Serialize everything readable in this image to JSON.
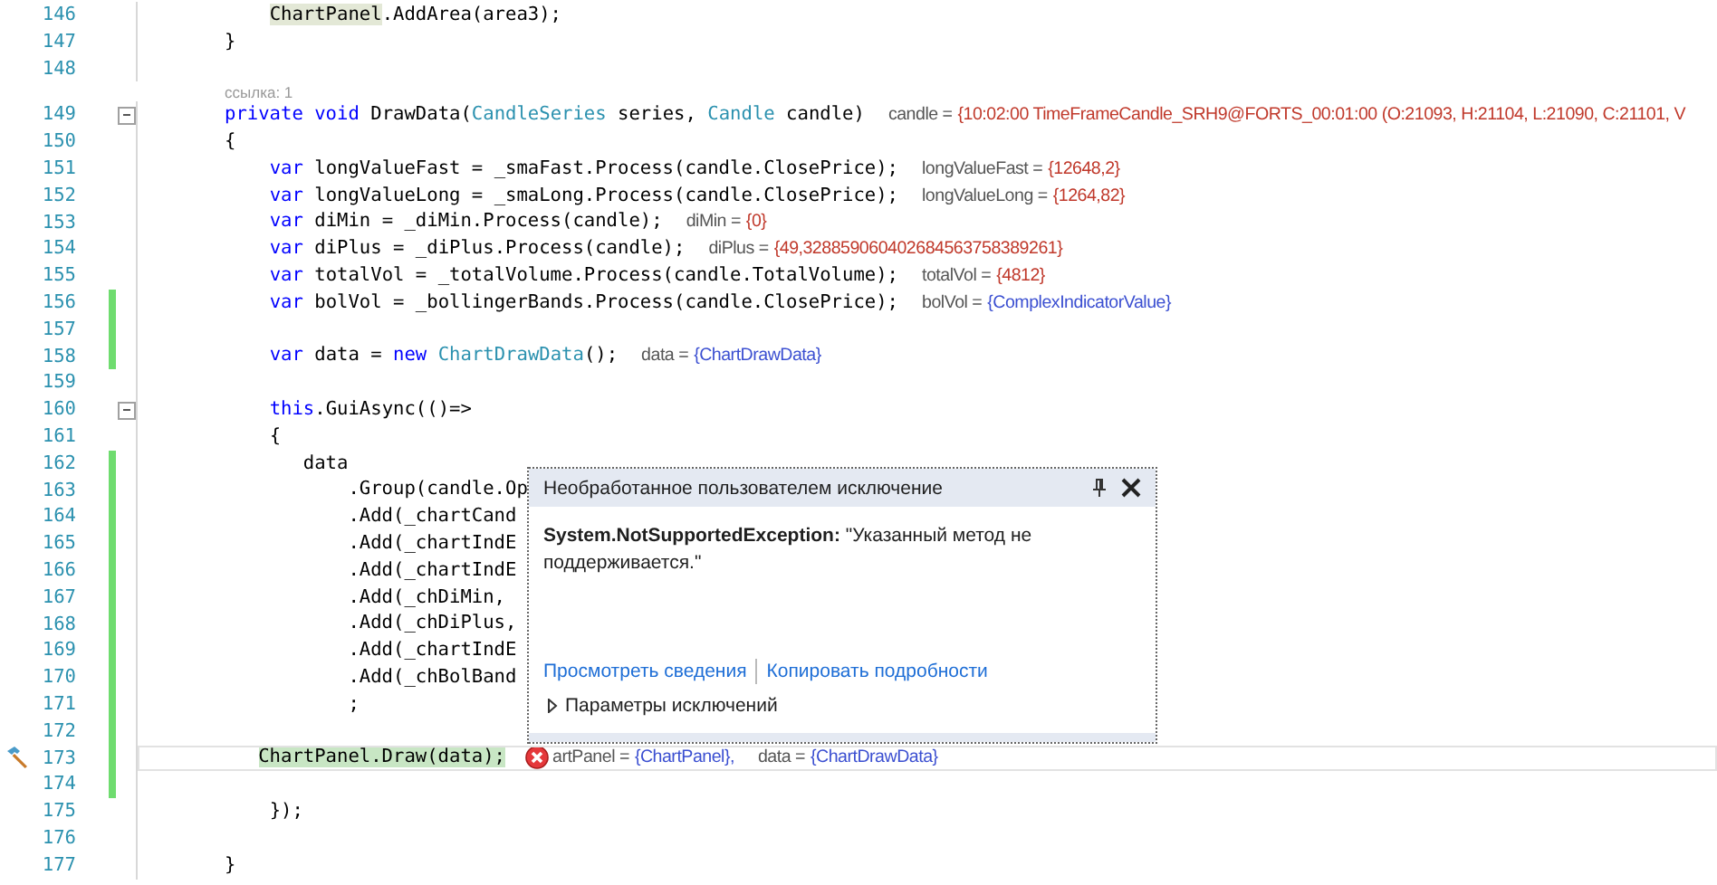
{
  "editor": {
    "lines": [
      {
        "number": "146",
        "changed": false,
        "tokens": [
          {
            "kind": "reference",
            "text": "    ChartPanel"
          },
          {
            "kind": "plain",
            "text": ".AddArea(area3);"
          }
        ]
      },
      {
        "number": "147",
        "changed": false,
        "tokens": [
          {
            "kind": "plain",
            "text": "}"
          }
        ]
      },
      {
        "number": "148",
        "changed": false
      },
      {
        "number": "149",
        "changed": false,
        "codelens": "ссылка: 1",
        "expanded": true,
        "tokens": [
          {
            "kind": "keyword",
            "text": "private"
          },
          {
            "kind": "keyword",
            "text": " void"
          },
          {
            "kind": "plain",
            "text": " DrawData("
          },
          {
            "kind": "type",
            "text": "CandleSeries"
          },
          {
            "kind": "plain",
            "text": " series,"
          },
          {
            "kind": "type",
            "text": " Candle"
          },
          {
            "kind": "plain",
            "text": " candle)"
          }
        ],
        "hints": [
          {
            "label": "candle =",
            "value": "{10:02:00 TimeFrameCandle_SRH9@FORTS_00:01:00 (O:21093, H:21104, L:21090, C:21101, V",
            "kind": "number"
          }
        ]
      },
      {
        "number": "150",
        "changed": false,
        "tokens": [
          {
            "kind": "plain",
            "text": "{"
          }
        ]
      },
      {
        "number": "151",
        "changed": false,
        "tokens": [
          {
            "kind": "keyword",
            "text": "    var"
          },
          {
            "kind": "plain",
            "text": " longValueFast = _smaFast.Process(candle.ClosePrice);"
          }
        ],
        "hints": [
          {
            "label": "longValueFast =",
            "value": "{12648,2}",
            "kind": "number"
          }
        ]
      },
      {
        "number": "152",
        "changed": false,
        "tokens": [
          {
            "kind": "keyword",
            "text": "    var"
          },
          {
            "kind": "plain",
            "text": " longValueLong = _smaLong.Process(candle.ClosePrice);"
          }
        ],
        "hints": [
          {
            "label": "longValueLong =",
            "value": "{1264,82}",
            "kind": "number"
          }
        ]
      },
      {
        "number": "153",
        "changed": false,
        "tokens": [
          {
            "kind": "keyword",
            "text": "    var"
          },
          {
            "kind": "plain",
            "text": " diMin = _diMin.Process(candle);"
          }
        ],
        "hints": [
          {
            "label": "diMin =",
            "value": "{0}",
            "kind": "number"
          }
        ]
      },
      {
        "number": "154",
        "changed": false,
        "tokens": [
          {
            "kind": "keyword",
            "text": "    var"
          },
          {
            "kind": "plain",
            "text": " diPlus = _diPlus.Process(candle);"
          }
        ],
        "hints": [
          {
            "label": "diPlus =",
            "value": "{49,328859060402684563758389261}",
            "kind": "number"
          }
        ]
      },
      {
        "number": "155",
        "changed": false,
        "tokens": [
          {
            "kind": "keyword",
            "text": "    var"
          },
          {
            "kind": "plain",
            "text": " totalVol = _totalVolume.Process(candle.TotalVolume);"
          }
        ],
        "hints": [
          {
            "label": "totalVol =",
            "value": "{4812}",
            "kind": "number"
          }
        ]
      },
      {
        "number": "156",
        "changed": true,
        "tokens": [
          {
            "kind": "keyword",
            "text": "    var"
          },
          {
            "kind": "plain",
            "text": " bolVol = _bollingerBands.Process(candle.ClosePrice);"
          }
        ],
        "hints": [
          {
            "label": "bolVol =",
            "value": "{ComplexIndicatorValue}",
            "kind": "type"
          }
        ]
      },
      {
        "number": "157",
        "changed": true
      },
      {
        "number": "158",
        "changed": true,
        "tokens": [
          {
            "kind": "keyword",
            "text": "    var"
          },
          {
            "kind": "plain",
            "text": " data ="
          },
          {
            "kind": "keyword",
            "text": " new"
          },
          {
            "kind": "type",
            "text": " ChartDrawData"
          },
          {
            "kind": "plain",
            "text": "();"
          }
        ],
        "hints": [
          {
            "label": "data =",
            "value": "{ChartDrawData}",
            "kind": "type"
          }
        ]
      },
      {
        "number": "159",
        "changed": false
      },
      {
        "number": "160",
        "changed": false,
        "expanded": true,
        "tokens": [
          {
            "kind": "keyword",
            "text": "    this"
          },
          {
            "kind": "plain",
            "text": ".GuiAsync(()=>"
          }
        ]
      },
      {
        "number": "161",
        "changed": false,
        "tokens": [
          {
            "kind": "plain",
            "text": "    {"
          }
        ]
      },
      {
        "number": "162",
        "changed": true,
        "tokens": [
          {
            "kind": "plain",
            "text": "       data"
          }
        ]
      },
      {
        "number": "163",
        "changed": true,
        "tokens": [
          {
            "kind": "plain",
            "text": "           .Group(candle.Op"
          }
        ]
      },
      {
        "number": "164",
        "changed": true,
        "tokens": [
          {
            "kind": "plain",
            "text": "           .Add(_chartCand"
          }
        ]
      },
      {
        "number": "165",
        "changed": true,
        "tokens": [
          {
            "kind": "plain",
            "text": "           .Add(_chartIndE"
          }
        ]
      },
      {
        "number": "166",
        "changed": true,
        "tokens": [
          {
            "kind": "plain",
            "text": "           .Add(_chartIndE"
          }
        ]
      },
      {
        "number": "167",
        "changed": true,
        "tokens": [
          {
            "kind": "plain",
            "text": "           .Add(_chDiMin,"
          }
        ]
      },
      {
        "number": "168",
        "changed": true,
        "tokens": [
          {
            "kind": "plain",
            "text": "           .Add(_chDiPlus,"
          }
        ]
      },
      {
        "number": "169",
        "changed": true,
        "tokens": [
          {
            "kind": "plain",
            "text": "           .Add(_chartIndE"
          }
        ]
      },
      {
        "number": "170",
        "changed": true,
        "tokens": [
          {
            "kind": "plain",
            "text": "           .Add(_chBolBand"
          }
        ]
      },
      {
        "number": "171",
        "changed": true,
        "tokens": [
          {
            "kind": "plain",
            "text": "           ;"
          }
        ]
      },
      {
        "number": "172",
        "changed": true
      },
      {
        "number": "173",
        "changed": true,
        "current": true,
        "exception": true,
        "tokens": [
          {
            "kind": "statement",
            "text": "   ChartPanel.Draw(data);"
          }
        ],
        "hints": [
          {
            "label": "artPanel =",
            "value": "{ChartPanel},",
            "kind": "type",
            "error": true
          },
          {
            "label": "data =",
            "value": "{ChartDrawData}",
            "kind": "type"
          }
        ]
      },
      {
        "number": "174",
        "changed": true
      },
      {
        "number": "175",
        "changed": false,
        "tokens": [
          {
            "kind": "plain",
            "text": "    });"
          }
        ]
      },
      {
        "number": "176",
        "changed": false
      },
      {
        "number": "177",
        "changed": false,
        "tokens": [
          {
            "kind": "plain",
            "text": "}"
          }
        ]
      }
    ]
  },
  "exception_popup": {
    "title": "Необработанное пользователем исключение",
    "message": "**System.NotSupportedException:** \"Указанный метод не поддерживается.\"",
    "links": [
      "Просмотреть сведения",
      "Копировать подробности"
    ],
    "settings": {
      "label": "Параметры исключений",
      "expanded": false
    }
  }
}
